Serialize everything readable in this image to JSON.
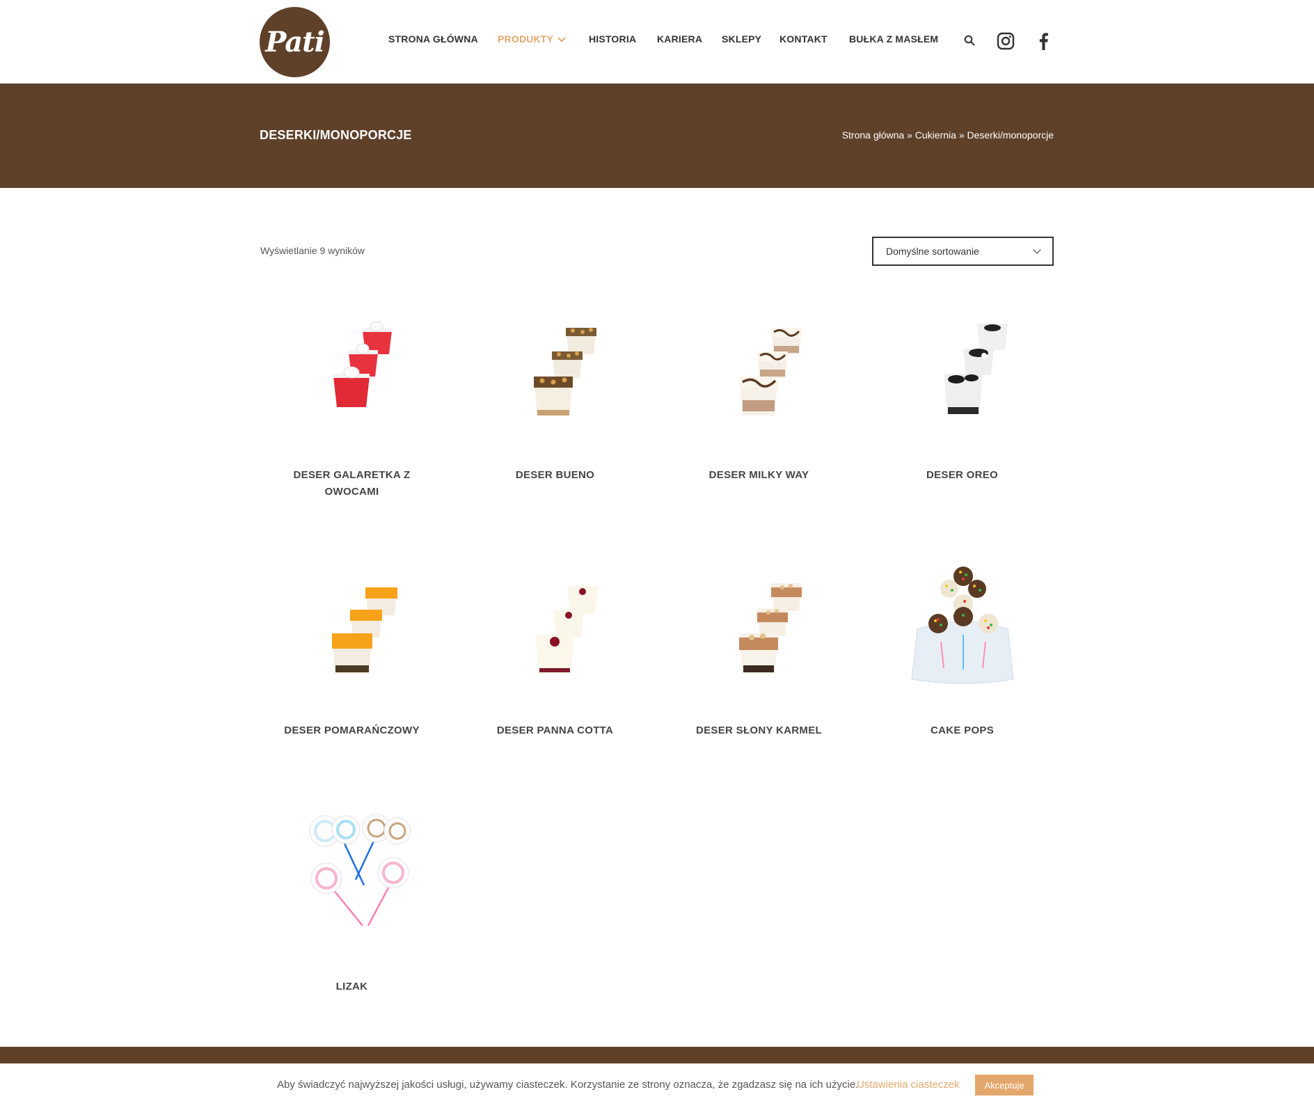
{
  "header": {
    "logo_text": "Pati",
    "nav": [
      {
        "label": "STRONA GŁÓWNA",
        "active": false
      },
      {
        "label": "PRODUKTY",
        "active": true
      },
      {
        "label": "HISTORIA",
        "active": false
      },
      {
        "label": "KARIERA",
        "active": false
      },
      {
        "label": "SKLEPY",
        "active": false
      },
      {
        "label": "KONTAKT",
        "active": false
      },
      {
        "label": "BUŁKA Z MASŁEM",
        "active": false
      }
    ],
    "icons": [
      "search-icon",
      "instagram-icon",
      "facebook-icon"
    ]
  },
  "page_title": {
    "title": "DESERKI/MONOPORCJE",
    "breadcrumb": {
      "home": "Strona główna",
      "sep": "»",
      "category": "Cukiernia",
      "current": "Deserki/monoporcje"
    }
  },
  "shop": {
    "result_count": "Wyświetlanie 9 wyników",
    "sort": {
      "selected": "Domyślne sortowanie"
    }
  },
  "products": [
    {
      "name": "DESER GALARETKA Z OWOCAMI"
    },
    {
      "name": "DESER BUENO"
    },
    {
      "name": "DESER MILKY WAY"
    },
    {
      "name": "DESER OREO"
    },
    {
      "name": "DESER POMARAŃCZOWY"
    },
    {
      "name": "DESER PANNA COTTA"
    },
    {
      "name": "DESER SŁONY KARMEL"
    },
    {
      "name": "CAKE POPS"
    },
    {
      "name": "LIZAK"
    }
  ],
  "cookie": {
    "text": "Aby świadczyć najwyższej jakości usługi, używamy ciasteczek. Korzystanie ze strony oznacza, że zgadzasz się na ich użycie.",
    "settings_link": "Ustawienia ciasteczek",
    "accept": "Akceptuje"
  },
  "colors": {
    "brand_brown": "#5f4029",
    "accent": "#e4a76b",
    "text": "#444444"
  }
}
